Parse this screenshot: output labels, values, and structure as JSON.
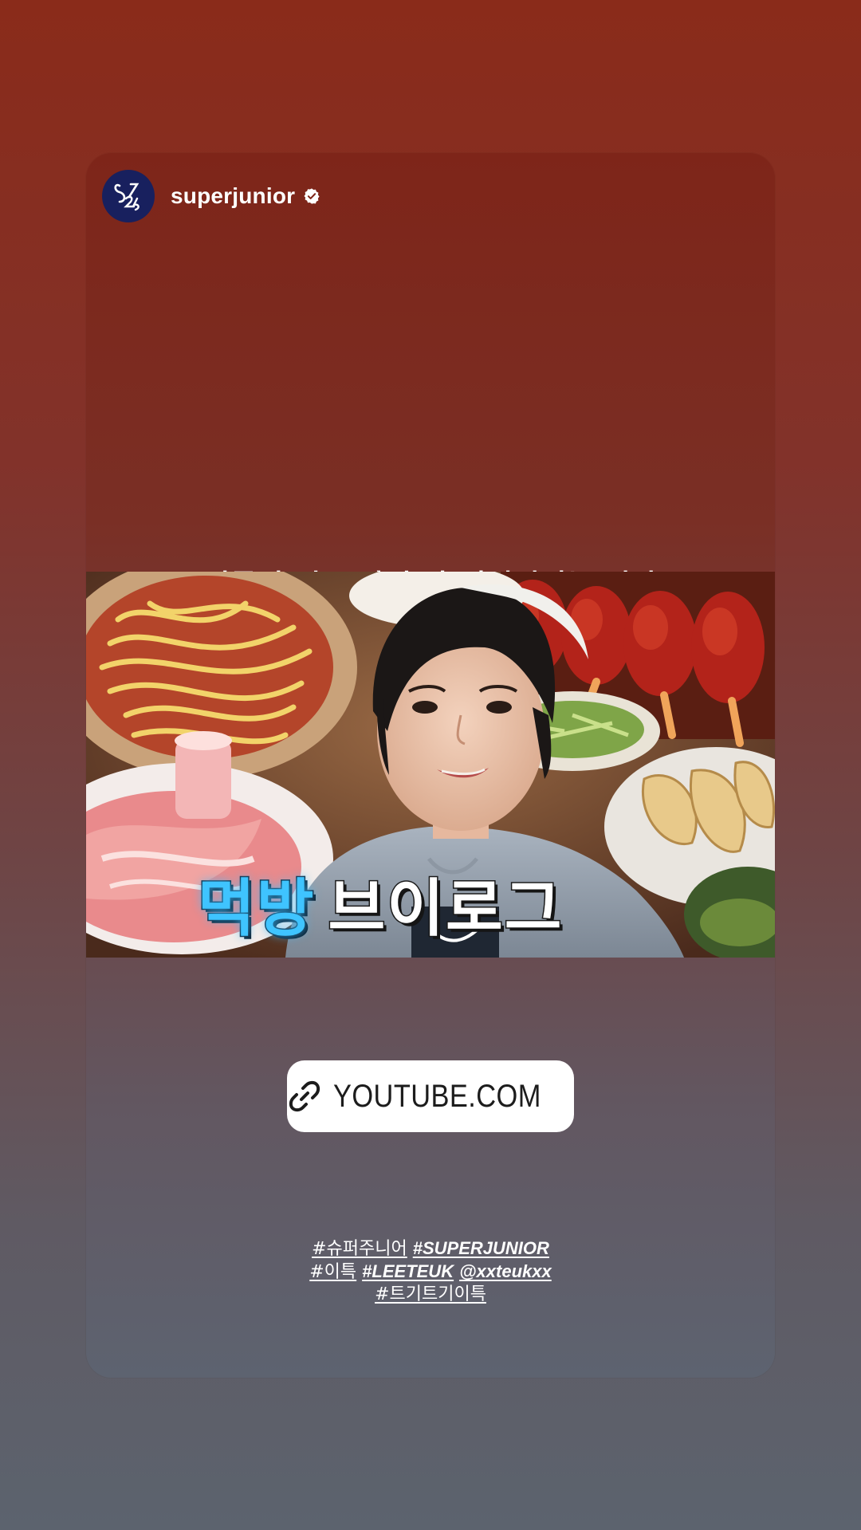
{
  "story": {
    "username": "superjunior",
    "avatar_label": "SJ",
    "caption": "이특의 일본 맛집 다 털어버리는 영상",
    "thumbnail": {
      "title_accent": "먹방",
      "title_plain": "브이로그"
    },
    "link_sticker": {
      "icon": "link-icon",
      "label": "YOUTUBE.COM"
    },
    "hashtags": {
      "line1": [
        "#슈퍼주니어",
        "#SUPERJUNIOR"
      ],
      "line2": [
        "#이특",
        "#LEETEUK",
        "@xxteukxx"
      ],
      "line3": [
        "#트기트기이특"
      ]
    }
  },
  "colors": {
    "accent_cyan": "#3fc4ff",
    "avatar_bg": "#18205e",
    "top_bg": "#8a2b1a",
    "bottom_bg": "#5c636e"
  }
}
